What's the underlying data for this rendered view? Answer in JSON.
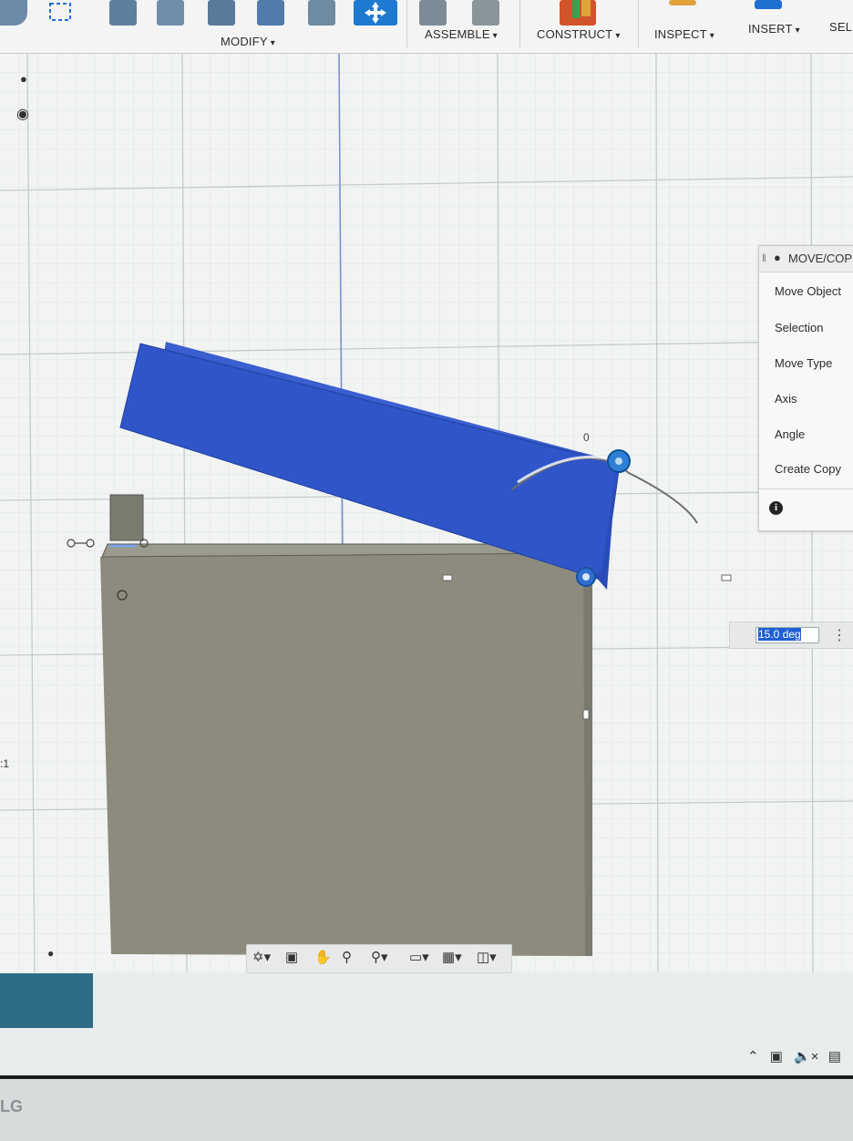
{
  "toolbar": {
    "groups": [
      {
        "label": "MODIFY"
      },
      {
        "label": "ASSEMBLE"
      },
      {
        "label": "CONSTRUCT"
      },
      {
        "label": "INSPECT"
      },
      {
        "label": "INSERT"
      },
      {
        "label": "SEL"
      }
    ]
  },
  "viewport": {
    "dimension_label": "0",
    "left_marker": ":1"
  },
  "move_copy_panel": {
    "title": "MOVE/COP",
    "rows": [
      "Move Object",
      "Selection",
      "Move Type",
      "Axis",
      "Angle",
      "Create Copy"
    ]
  },
  "angle_input": {
    "value": "15.0 deg"
  },
  "brand": "LG",
  "colors": {
    "lid": "#2f55c8",
    "box": "#8e8d80",
    "accent": "#1f6fd0"
  }
}
